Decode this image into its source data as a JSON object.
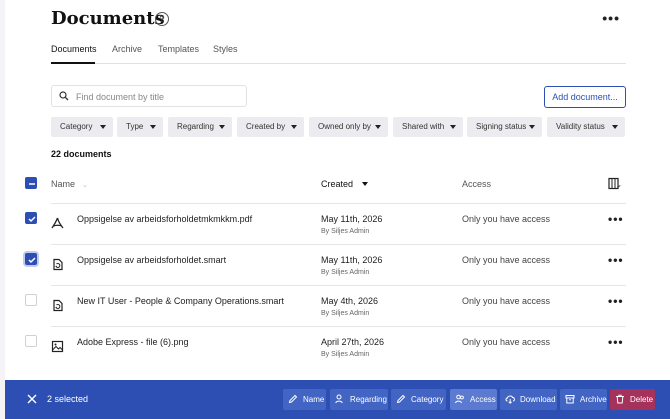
{
  "page": {
    "title": "Documents",
    "help_icon": "?",
    "more_icon": "•••"
  },
  "tabs": [
    {
      "label": "Documents",
      "active": true
    },
    {
      "label": "Archive",
      "active": false
    },
    {
      "label": "Templates",
      "active": false
    },
    {
      "label": "Styles",
      "active": false
    }
  ],
  "search": {
    "placeholder": "Find document by title",
    "value": ""
  },
  "add_document_label": "Add document...",
  "filters": [
    "Category",
    "Type",
    "Regarding",
    "Created by",
    "Owned only by",
    "Shared with",
    "Signing status",
    "Validity status"
  ],
  "document_count": "22 documents",
  "table": {
    "headers": {
      "name": "Name",
      "created": "Created",
      "access": "Access"
    },
    "rows": [
      {
        "name": "Oppsigelse av arbeidsforholdetmkmkkm.pdf",
        "icon": "pdf-icon",
        "date": "May 11th, 2026",
        "by": "By Siljes Admin",
        "access": "Only you have access",
        "checked": true
      },
      {
        "name": "Oppsigelse av arbeidsforholdet.smart",
        "icon": "smart-doc-icon",
        "date": "May 11th, 2026",
        "by": "By Siljes Admin",
        "access": "Only you have access",
        "checked": true
      },
      {
        "name": "New IT User - People & Company Operations.smart",
        "icon": "smart-doc-icon",
        "date": "May 4th, 2026",
        "by": "By Siljes Admin",
        "access": "Only you have access",
        "checked": false
      },
      {
        "name": "Adobe Express - file (6).png",
        "icon": "image-icon",
        "date": "April 27th, 2026",
        "by": "By Siljes Admin",
        "access": "Only you have access",
        "checked": false
      }
    ]
  },
  "bulk_bar": {
    "selected_text": "2 selected",
    "actions": [
      "Name",
      "Regarding",
      "Category",
      "Access",
      "Download",
      "Archive",
      "Delete"
    ]
  },
  "colors": {
    "accent": "#2d4fb3",
    "delete": "#a4325a",
    "filter_bg": "#ececf0"
  }
}
